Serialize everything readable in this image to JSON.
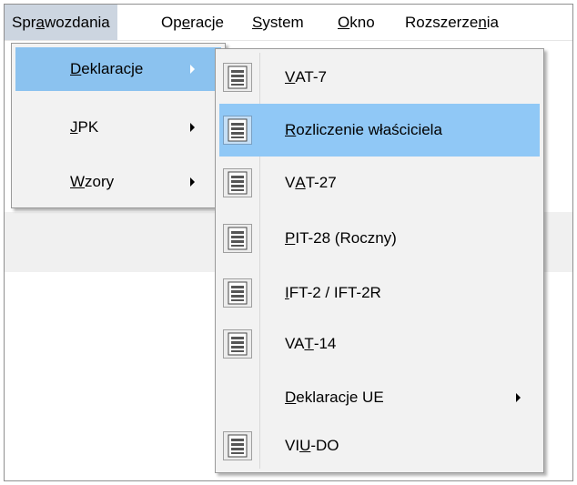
{
  "menubar": [
    {
      "pre": "Spr",
      "u": "a",
      "post": "wozdania",
      "active": true
    },
    {
      "pre": "Op",
      "u": "e",
      "post": "racje"
    },
    {
      "pre": "",
      "u": "S",
      "post": "ystem"
    },
    {
      "pre": "",
      "u": "O",
      "post": "kno"
    },
    {
      "pre": "Rozszerze",
      "u": "n",
      "post": "ia"
    }
  ],
  "sprawozdania_menu": [
    {
      "pre": "",
      "u": "D",
      "post": "eklaracje",
      "submenu": true,
      "highlighted": true
    },
    {
      "pre": "",
      "u": "J",
      "post": "PK",
      "submenu": true
    },
    {
      "pre": "",
      "u": "W",
      "post": "zory",
      "submenu": true
    }
  ],
  "deklaracje_submenu": [
    {
      "pre": "",
      "u": "V",
      "post": "AT-7",
      "icon": "form-document-icon"
    },
    {
      "pre": "",
      "u": "R",
      "post": "ozliczenie właściciela",
      "icon": "form-document-icon",
      "highlighted": true
    },
    {
      "pre": "V",
      "u": "A",
      "post": "T-27",
      "icon": "form-document-icon"
    },
    {
      "pre": "",
      "u": "P",
      "post": "IT-28 (Roczny)",
      "icon": "form-document-icon"
    },
    {
      "pre": "",
      "u": "I",
      "post": "FT-2 / IFT-2R",
      "icon": "form-document-icon"
    },
    {
      "pre": "VA",
      "u": "T",
      "post": "-14",
      "icon": "form-document-icon"
    },
    {
      "pre": "",
      "u": "D",
      "post": "eklaracje UE",
      "submenu": true
    },
    {
      "pre": "VI",
      "u": "U",
      "post": "-DO",
      "icon": "form-document-icon"
    }
  ],
  "colors": {
    "menu_bg": "#f2f2f2",
    "highlight": "#8bc2ef",
    "menubar_active": "#ccd5e0"
  }
}
